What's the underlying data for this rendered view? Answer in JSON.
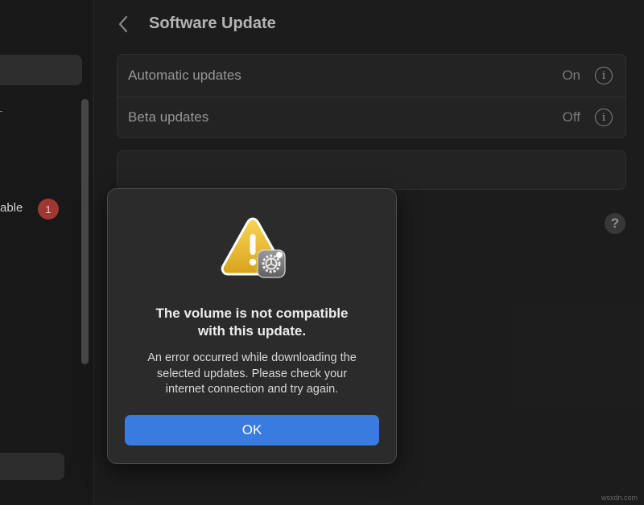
{
  "sidebar": {
    "item_label": "able",
    "badge_count": "1"
  },
  "header": {
    "title": "Software Update",
    "back_icon": "chevron-left-icon"
  },
  "settings": {
    "rows": [
      {
        "label": "Automatic updates",
        "value": "On"
      },
      {
        "label": "Beta updates",
        "value": "Off"
      }
    ],
    "info_glyph": "i"
  },
  "help": {
    "glyph": "?"
  },
  "dialog": {
    "icon": "warning-triangle-with-gear-icon",
    "title_line1": "The volume is not compatible",
    "title_line2": "with this update.",
    "message_line1": "An error occurred while downloading the",
    "message_line2": "selected updates. Please check your",
    "message_line3": "internet connection and try again.",
    "ok_label": "OK"
  },
  "watermark": "wsxdn.com",
  "colors": {
    "accent": "#3a7be0",
    "badge": "#a63a36",
    "warning": "#f2c23a"
  }
}
